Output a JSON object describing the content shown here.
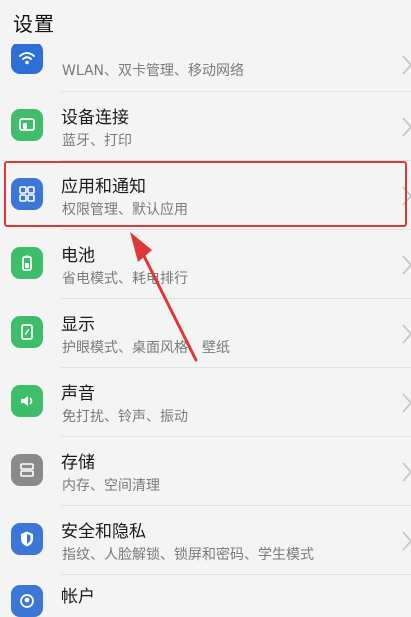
{
  "header": {
    "title": "设置"
  },
  "items": [
    {
      "name": "wlan",
      "title": "",
      "subtitle": "WLAN、双卡管理、移动网络",
      "icon": "wifi-icon",
      "color": "#2d6fd6"
    },
    {
      "name": "device-connection",
      "title": "设备连接",
      "subtitle": "蓝牙、打印",
      "icon": "device-connection-icon",
      "color": "#3ebd6a"
    },
    {
      "name": "apps-notifications",
      "title": "应用和通知",
      "subtitle": "权限管理、默认应用",
      "icon": "apps-grid-icon",
      "color": "#3b76d8"
    },
    {
      "name": "battery",
      "title": "电池",
      "subtitle": "省电模式、耗电排行",
      "icon": "battery-icon",
      "color": "#3ebd6a"
    },
    {
      "name": "display",
      "title": "显示",
      "subtitle": "护眼模式、桌面风格、壁纸",
      "icon": "display-icon",
      "color": "#3ebd6a"
    },
    {
      "name": "sound",
      "title": "声音",
      "subtitle": "免打扰、铃声、振动",
      "icon": "speaker-icon",
      "color": "#3ebd6a"
    },
    {
      "name": "storage",
      "title": "存储",
      "subtitle": "内存、空间清理",
      "icon": "storage-icon",
      "color": "#8a8a8a"
    },
    {
      "name": "security-privacy",
      "title": "安全和隐私",
      "subtitle": "指纹、人脸解锁、锁屏和密码、学生模式",
      "icon": "shield-icon",
      "color": "#3b76d8"
    },
    {
      "name": "account",
      "title": "帐户",
      "subtitle": "",
      "icon": "account-icon",
      "color": "#3b76d8"
    }
  ]
}
